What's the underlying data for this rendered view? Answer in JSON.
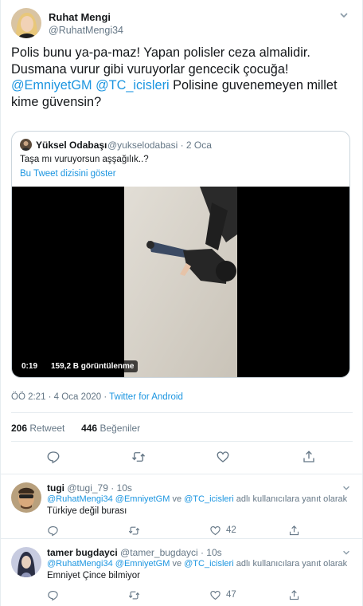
{
  "tweet": {
    "author_name": "Ruhat Mengi",
    "author_handle": "@RuhatMengi34",
    "text_lines": [
      "Polis bunu ya-pa-maz! Yapan polisler ceza almalidir.",
      "Dusmana vurur gibi vuruyorlar gencecik çocuğa!"
    ],
    "mention_1": "@EmniyetGM",
    "mention_2": "@TC_icisleri",
    "text_line3_tail": " Polisine guvenemeyen millet",
    "text_line4": "kime güvensin?",
    "timestamp": "ÖÖ 2:21 · 4 Oca 2020 · ",
    "source": "Twitter for Android",
    "retweet_count": "206",
    "retweet_label": " Retweet",
    "like_count": "446",
    "like_label": " Beğeniler"
  },
  "quoted": {
    "author_name": "Yüksel Odabaşı",
    "meta": "@yukselodabasi · 2 Oca",
    "text": "Taşa mı vuruyorsun aşşağılık..?",
    "thread_link": "Bu Tweet dizisini göster",
    "video_time": "0:19",
    "video_views": "159,2 B görüntülenme"
  },
  "replies": [
    {
      "name": "tugi",
      "meta": "@tugi_79 · 10s",
      "mention_a": "@RuhatMengi34",
      "mention_b": "@EmniyetGM",
      "conj": " ve ",
      "mention_c": "@TC_icisleri",
      "suffix": " adlı kullanıcılara yanıt olarak",
      "text": "Türkiye değil burası",
      "likes": "42"
    },
    {
      "name": "tamer bugdayci",
      "meta": "@tamer_bugdayci · 10s",
      "mention_a": "@RuhatMengi34",
      "mention_b": "@EmniyetGM",
      "conj": " ve ",
      "mention_c": "@TC_icisleri",
      "suffix": " adlı kullanıcılara yanıt olarak",
      "text": "Emniyet Çince bilmiyor",
      "likes": "47"
    }
  ],
  "icons": [
    "chevron-down-icon",
    "reply-icon",
    "retweet-icon",
    "like-icon",
    "share-icon"
  ],
  "colors": {
    "accent": "#1b95e0",
    "muted": "#657786",
    "text": "#14171a",
    "border": "#e6ecf0"
  }
}
